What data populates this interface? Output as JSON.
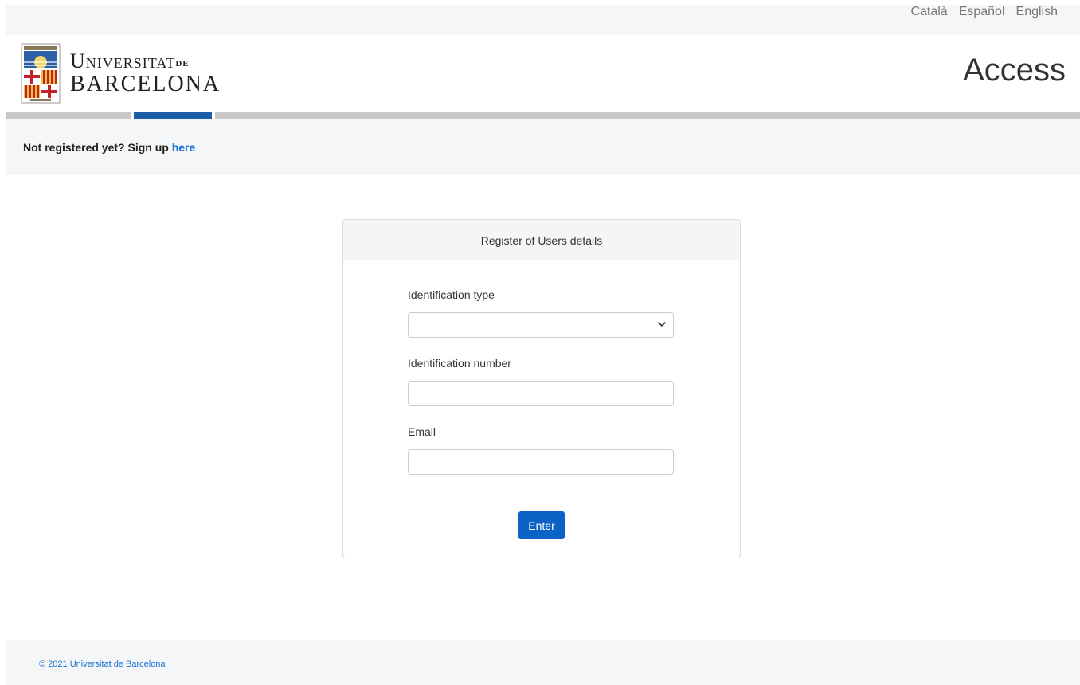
{
  "languages": [
    "Català",
    "Español",
    "English"
  ],
  "header": {
    "logo_line1": "Universitat",
    "logo_de": "DE",
    "logo_line2": "BARCELONA",
    "title": "Access"
  },
  "signup": {
    "prefix": "Not registered yet? Sign up",
    "link": "here"
  },
  "form": {
    "title": "Register of Users details",
    "id_type_label": "Identification type",
    "id_type_value": "",
    "id_number_label": "Identification number",
    "id_number_value": "",
    "email_label": "Email",
    "email_value": "",
    "submit_label": "Enter"
  },
  "footer": {
    "copyright": "© 2021 Universitat de Barcelona"
  },
  "colors": {
    "accent": "#0b63c5",
    "link": "#1572d3",
    "stripe_blue": "#1b5ea8"
  }
}
